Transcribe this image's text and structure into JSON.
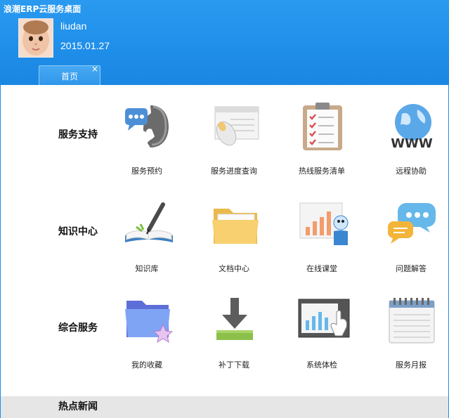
{
  "app": {
    "title": "浪潮ERP云服务桌面"
  },
  "user": {
    "name": "liudan",
    "date": "2015.01.27"
  },
  "tabs": [
    {
      "label": "首页",
      "close": "×"
    }
  ],
  "sections": [
    {
      "title": "服务支持",
      "items": [
        {
          "label": "服务预约",
          "icon": "phone-icon"
        },
        {
          "label": "服务进度查询",
          "icon": "mouse-window-icon"
        },
        {
          "label": "热线服务清单",
          "icon": "clipboard-checklist-icon"
        },
        {
          "label": "远程协助",
          "icon": "globe-www-icon"
        }
      ]
    },
    {
      "title": "知识中心",
      "items": [
        {
          "label": "知识库",
          "icon": "book-pen-icon"
        },
        {
          "label": "文档中心",
          "icon": "folder-icon"
        },
        {
          "label": "在线课堂",
          "icon": "classroom-icon"
        },
        {
          "label": "问题解答",
          "icon": "chat-bubbles-icon"
        }
      ]
    },
    {
      "title": "综合服务",
      "items": [
        {
          "label": "我的收藏",
          "icon": "favorite-folder-icon"
        },
        {
          "label": "补丁下载",
          "icon": "download-icon"
        },
        {
          "label": "系统体检",
          "icon": "system-check-icon"
        },
        {
          "label": "服务月报",
          "icon": "calendar-notebook-icon"
        }
      ]
    }
  ],
  "news": {
    "title": "热点新闻"
  }
}
